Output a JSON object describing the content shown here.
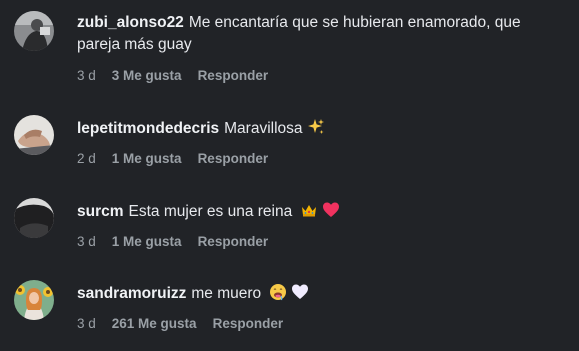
{
  "comments": [
    {
      "username": "zubi_alonso22",
      "text": "Me encantaría que se hubieran enamorado, que pareja más guay",
      "time": "3 d",
      "likes": "3 Me gusta",
      "reply": "Responder",
      "avatar_icon": "profile-photo-dark"
    },
    {
      "username": "lepetitmondedecris",
      "text": "Maravillosa",
      "emoji": [
        "sparkles-icon"
      ],
      "time": "2 d",
      "likes": "1 Me gusta",
      "reply": "Responder",
      "avatar_icon": "profile-photo-hands"
    },
    {
      "username": "surcm",
      "text": "Esta mujer es una reina",
      "emoji": [
        "crown-icon",
        "red-heart-icon"
      ],
      "time": "3 d",
      "likes": "1 Me gusta",
      "reply": "Responder",
      "avatar_icon": "profile-photo-dark-figure"
    },
    {
      "username": "sandramoruizz",
      "text": "me muero",
      "emoji": [
        "drooling-face-icon",
        "white-heart-icon"
      ],
      "time": "3 d",
      "likes": "261 Me gusta",
      "reply": "Responder",
      "avatar_icon": "profile-photo-sunflowers"
    }
  ],
  "colors": {
    "background": "#212327",
    "text": "#e7e9ed",
    "muted": "#9aa0a6"
  }
}
